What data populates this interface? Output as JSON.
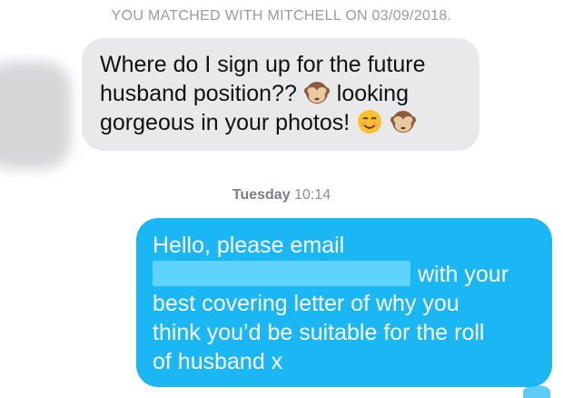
{
  "match_banner": "YOU MATCHED WITH MITCHELL ON 03/09/2018.",
  "incoming": {
    "line1": "Where do I sign up for the future",
    "line2": "husband position??",
    "line2b": "looking",
    "line3": "gorgeous in your photos!",
    "emoji_1": "see-no-evil-monkey",
    "emoji_2": "smiling-face",
    "emoji_3": "see-no-evil-monkey"
  },
  "timestamp": {
    "day": "Tuesday",
    "time": "10:14"
  },
  "outgoing": {
    "line1": "Hello, please email",
    "line2": "with your",
    "line3": "best covering letter of why you",
    "line4": "think you’d be suitable for the roll",
    "line5": "of husband x"
  },
  "colors": {
    "incoming_bubble": "#e9e9eb",
    "outgoing_bubble": "#1ab7f4",
    "redaction": "#5fd3fb"
  }
}
